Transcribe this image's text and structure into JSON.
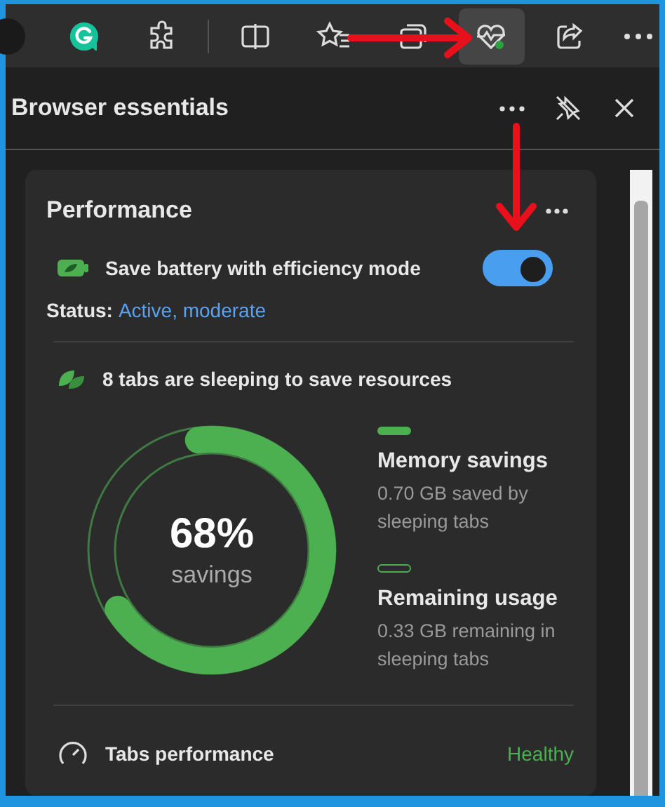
{
  "toolbar": {
    "buttons": [
      {
        "kind": "profile",
        "selected": false
      },
      {
        "kind": "grammarly",
        "selected": false
      },
      {
        "kind": "extensions",
        "selected": false
      },
      {
        "kind": "split",
        "selected": false
      },
      {
        "kind": "favorites",
        "selected": false
      },
      {
        "kind": "collections",
        "selected": false
      },
      {
        "kind": "essentials",
        "selected": true
      },
      {
        "kind": "share",
        "selected": false
      },
      {
        "kind": "more",
        "selected": false
      }
    ]
  },
  "panel": {
    "title": "Browser essentials"
  },
  "card": {
    "title": "Performance",
    "efficiency": {
      "label": "Save battery with efficiency mode",
      "on": true
    },
    "status": {
      "label": "Status:",
      "value": "Active, moderate"
    },
    "sleeping": "8 tabs are sleeping to save resources",
    "savings": {
      "level": 0.68,
      "percent": "68%",
      "caption": "savings"
    },
    "legend": [
      {
        "kind": "filled",
        "title": "Memory savings",
        "description": "0.70 GB saved by sleeping tabs"
      },
      {
        "kind": "outline",
        "title": "Remaining usage",
        "description": "0.33 GB remaining in sleeping tabs"
      }
    ],
    "tabs_performance": {
      "label": "Tabs performance",
      "status": "Healthy"
    }
  }
}
